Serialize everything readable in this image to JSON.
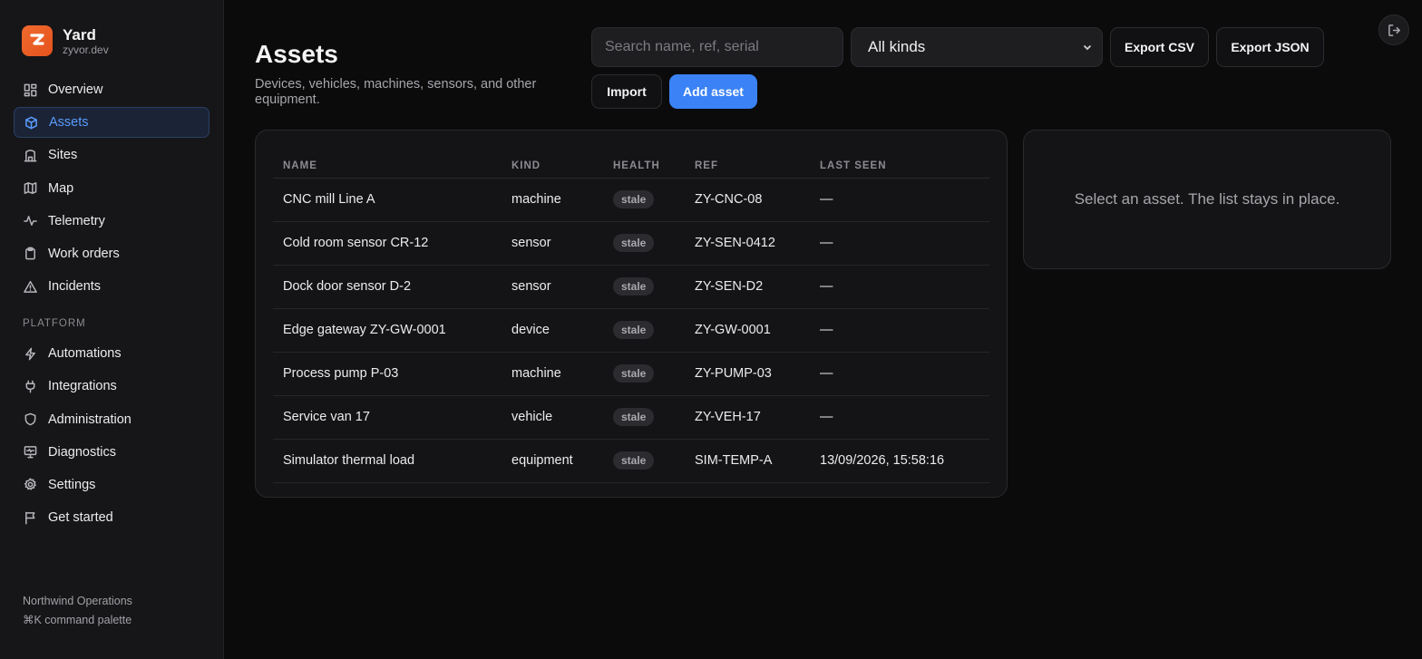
{
  "brand": {
    "name": "Yard",
    "domain": "zyvor.dev",
    "logo_letter": "Z"
  },
  "sidebar": {
    "items": [
      {
        "label": "Overview",
        "icon": "layout-dashboard-icon"
      },
      {
        "label": "Assets",
        "icon": "box-icon",
        "active": true
      },
      {
        "label": "Sites",
        "icon": "building-icon"
      },
      {
        "label": "Map",
        "icon": "map-icon"
      },
      {
        "label": "Telemetry",
        "icon": "activity-icon"
      },
      {
        "label": "Work orders",
        "icon": "clipboard-icon"
      },
      {
        "label": "Incidents",
        "icon": "alert-triangle-icon"
      }
    ],
    "section_label": "PLATFORM",
    "platform_items": [
      {
        "label": "Automations",
        "icon": "zap-icon"
      },
      {
        "label": "Integrations",
        "icon": "plug-icon"
      },
      {
        "label": "Administration",
        "icon": "shield-icon"
      },
      {
        "label": "Diagnostics",
        "icon": "monitor-icon"
      },
      {
        "label": "Settings",
        "icon": "gear-icon"
      },
      {
        "label": "Get started",
        "icon": "flag-icon"
      }
    ],
    "footer": {
      "org": "Northwind Operations",
      "shortcut": "⌘K command palette"
    }
  },
  "header": {
    "title": "Assets",
    "subtitle": "Devices, vehicles, machines, sensors, and other equipment.",
    "search_placeholder": "Search name, ref, serial",
    "search_value": "",
    "kind_filter": "All kinds",
    "export_csv": "Export CSV",
    "export_json": "Export JSON",
    "import": "Import",
    "add_asset": "Add asset"
  },
  "table": {
    "columns": [
      "NAME",
      "KIND",
      "HEALTH",
      "REF",
      "LAST SEEN"
    ],
    "rows": [
      {
        "name": "CNC mill Line A",
        "kind": "machine",
        "health": "stale",
        "ref": "ZY-CNC-08",
        "last_seen": "—"
      },
      {
        "name": "Cold room sensor CR-12",
        "kind": "sensor",
        "health": "stale",
        "ref": "ZY-SEN-0412",
        "last_seen": "—"
      },
      {
        "name": "Dock door sensor D-2",
        "kind": "sensor",
        "health": "stale",
        "ref": "ZY-SEN-D2",
        "last_seen": "—"
      },
      {
        "name": "Edge gateway ZY-GW-0001",
        "kind": "device",
        "health": "stale",
        "ref": "ZY-GW-0001",
        "last_seen": "—"
      },
      {
        "name": "Process pump P-03",
        "kind": "machine",
        "health": "stale",
        "ref": "ZY-PUMP-03",
        "last_seen": "—"
      },
      {
        "name": "Service van 17",
        "kind": "vehicle",
        "health": "stale",
        "ref": "ZY-VEH-17",
        "last_seen": "—"
      },
      {
        "name": "Simulator thermal load",
        "kind": "equipment",
        "health": "stale",
        "ref": "SIM-TEMP-A",
        "last_seen": "13/09/2026, 15:58:16"
      }
    ]
  },
  "detail": {
    "empty_text": "Select an asset. The list stays in place."
  },
  "colors": {
    "accent": "#3b82f6",
    "logo": "#ef5f26",
    "background": "#0b0b0c",
    "sidebar": "#161618"
  }
}
